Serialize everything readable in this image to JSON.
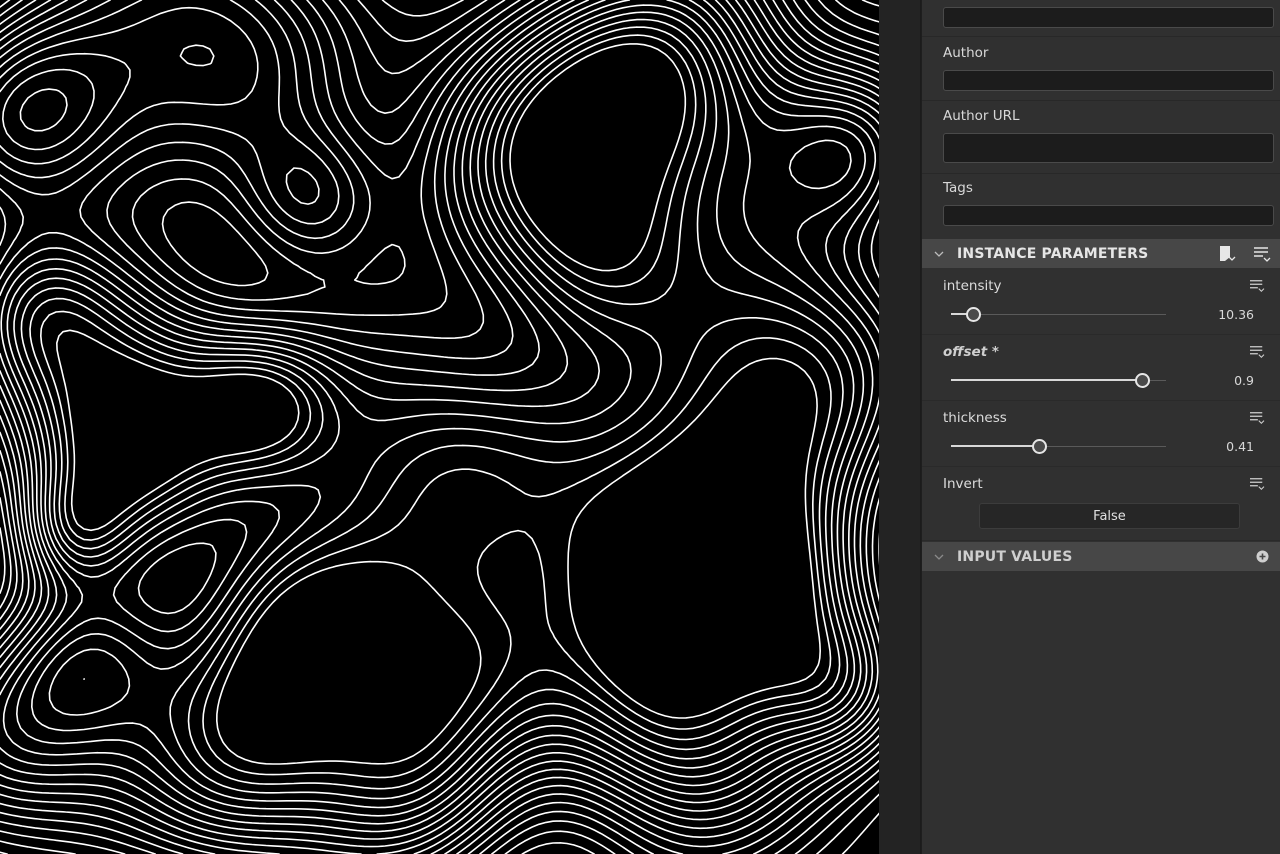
{
  "metadata_panel": {
    "author_label": "Author",
    "author_value": "",
    "author_url_label": "Author URL",
    "author_url_value": "",
    "tags_label": "Tags",
    "tags_value": ""
  },
  "instance_parameters": {
    "title": "INSTANCE PARAMETERS",
    "params": [
      {
        "name": "intensity",
        "value": "10.36",
        "fraction": 0.1
      },
      {
        "name": "offset *",
        "value": "0.9",
        "fraction": 0.89
      },
      {
        "name": "thickness",
        "value": "0.41",
        "fraction": 0.41
      }
    ],
    "invert": {
      "name": "Invert",
      "value": "False"
    }
  },
  "input_values": {
    "title": "INPUT VALUES"
  },
  "colors": {
    "accent": "#474747",
    "panel_bg": "#303030",
    "field_bg": "#1c1c1c",
    "viewport_bg": "#000000",
    "contour": "#ffffff"
  },
  "icons": [
    "chevron-down-icon",
    "preset-icon",
    "menu-list-icon",
    "add-circle-icon"
  ]
}
